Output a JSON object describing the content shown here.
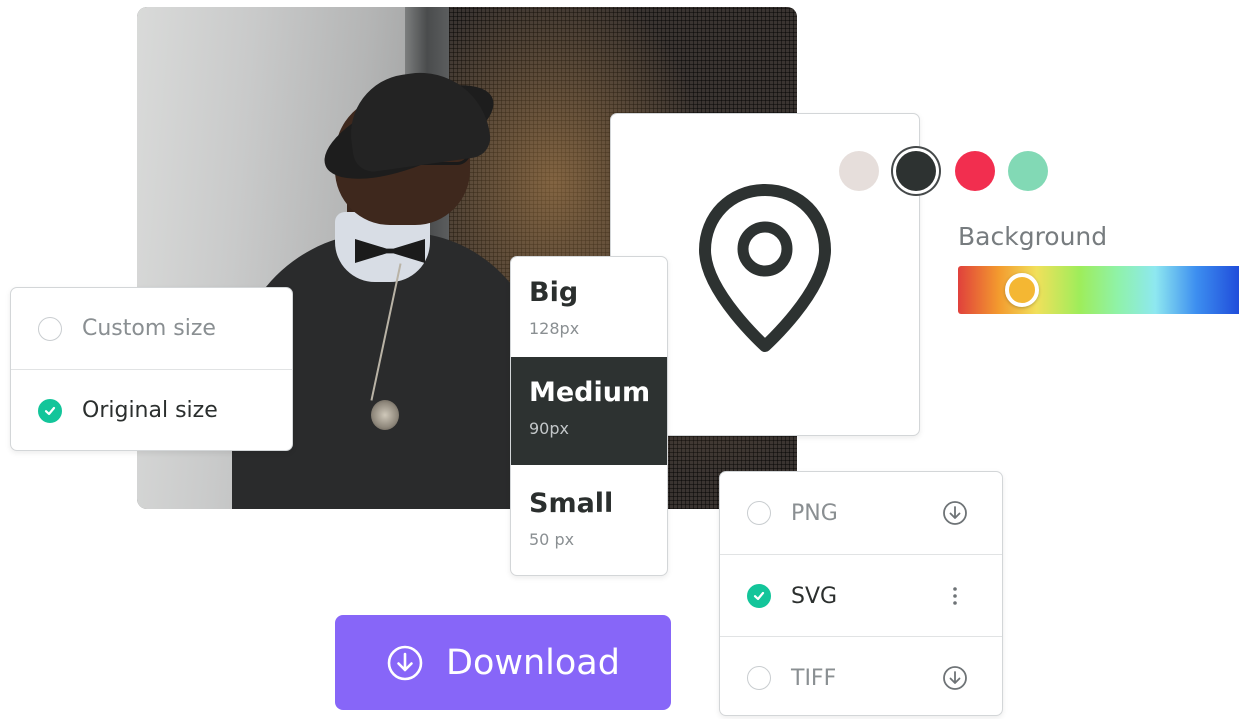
{
  "size_options": [
    {
      "label": "Custom size",
      "checked": false
    },
    {
      "label": "Original size",
      "checked": true
    }
  ],
  "dimensions": [
    {
      "name": "Big",
      "value": "128px",
      "active": false
    },
    {
      "name": "Medium",
      "value": "90px",
      "active": true
    },
    {
      "name": "Small",
      "value": "50  px",
      "active": false
    }
  ],
  "preview": {
    "icon": "map-pin-icon",
    "icon_color": "#2d3231"
  },
  "color_swatches": [
    {
      "name": "light-gray",
      "color": "#e6dedb",
      "selected": false
    },
    {
      "name": "charcoal",
      "color": "#2d3231",
      "selected": true
    },
    {
      "name": "red",
      "color": "#f22e4f",
      "selected": false
    },
    {
      "name": "mint",
      "color": "#82d9b5",
      "selected": false
    }
  ],
  "background": {
    "label": "Background",
    "value": 0.22,
    "knob_color": "#f4b733"
  },
  "formats": [
    {
      "label": "PNG",
      "checked": false,
      "action": "download-icon"
    },
    {
      "label": "SVG",
      "checked": true,
      "action": "more-vertical-icon"
    },
    {
      "label": "TIFF",
      "checked": false,
      "action": "download-icon"
    }
  ],
  "download": {
    "label": "Download",
    "icon": "download-icon",
    "color": "#8766f8"
  },
  "accent_color": "#13c59a"
}
